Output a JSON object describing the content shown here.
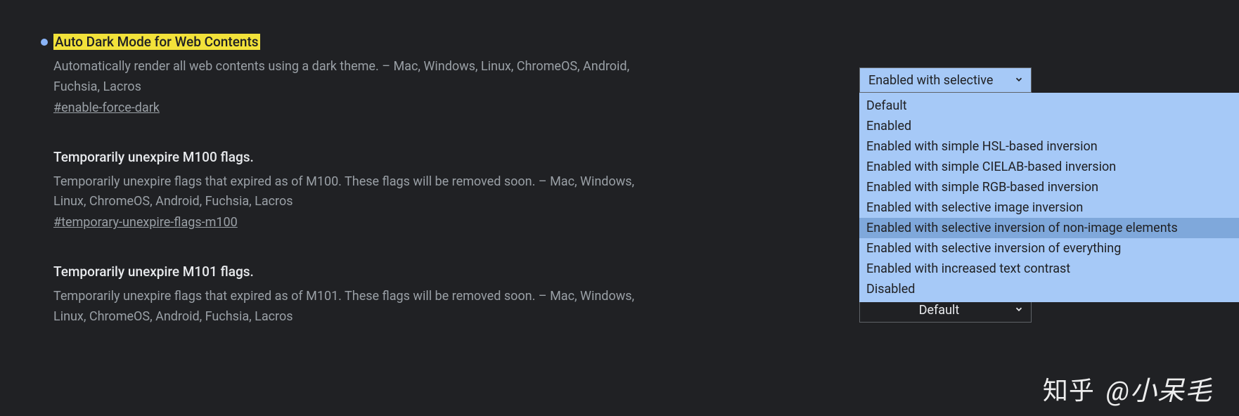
{
  "flags": [
    {
      "title": "Auto Dark Mode for Web Contents",
      "highlighted": true,
      "has_dot": true,
      "description": "Automatically render all web contents using a dark theme. – Mac, Windows, Linux, ChromeOS, Android, Fuchsia, Lacros",
      "hash": "#enable-force-dark",
      "select_value": "Enabled with selective",
      "select_style": "light",
      "dropdown_open": true
    },
    {
      "title": "Temporarily unexpire M100 flags.",
      "highlighted": false,
      "has_dot": false,
      "description": "Temporarily unexpire flags that expired as of M100. These flags will be removed soon. – Mac, Windows, Linux, ChromeOS, Android, Fuchsia, Lacros",
      "hash": "#temporary-unexpire-flags-m100",
      "select_value": "",
      "select_style": "none"
    },
    {
      "title": "Temporarily unexpire M101 flags.",
      "highlighted": false,
      "has_dot": false,
      "description": "Temporarily unexpire flags that expired as of M101. These flags will be removed soon. – Mac, Windows, Linux, ChromeOS, Android, Fuchsia, Lacros",
      "hash": "",
      "select_value": "Default",
      "select_style": "dark"
    }
  ],
  "dropdown_options": [
    "Default",
    "Enabled",
    "Enabled with simple HSL-based inversion",
    "Enabled with simple CIELAB-based inversion",
    "Enabled with simple RGB-based inversion",
    "Enabled with selective image inversion",
    "Enabled with selective inversion of non-image elements",
    "Enabled with selective inversion of everything",
    "Enabled with increased text contrast",
    "Disabled"
  ],
  "dropdown_selected_index": 6,
  "watermark": {
    "logo": "知乎",
    "author": "@小呆毛"
  }
}
